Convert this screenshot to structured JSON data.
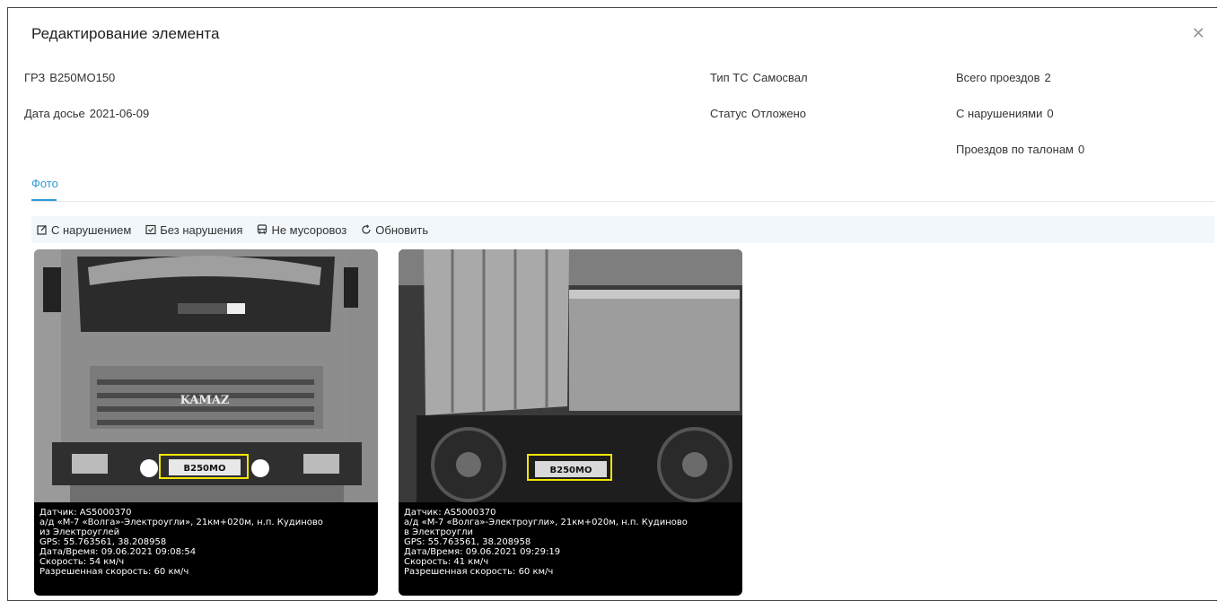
{
  "dialog": {
    "title": "Редактирование элемента",
    "close_icon": "close-icon"
  },
  "fields": {
    "grz": {
      "label": "ГРЗ",
      "value": "В250МО150"
    },
    "dossier_date": {
      "label": "Дата досье",
      "value": "2021-06-09"
    },
    "vehicle_type": {
      "label": "Тип ТС",
      "value": "Самосвал"
    },
    "status": {
      "label": "Статус",
      "value": "Отложено"
    },
    "total_passes": {
      "label": "Всего проездов",
      "value": "2"
    },
    "with_violations": {
      "label": "С нарушениями",
      "value": "0"
    },
    "coupon_passes": {
      "label": "Проездов по талонам",
      "value": "0"
    }
  },
  "tabs": [
    {
      "label": "Фото",
      "active": true
    }
  ],
  "toolbar": {
    "with_violation": "С нарушением",
    "without_violation": "Без нарушения",
    "not_garbage_truck": "Не мусоровоз",
    "refresh": "Обновить"
  },
  "photos": [
    {
      "plate": "В250МО",
      "region": "150",
      "brand": "KAMAZ",
      "caption": [
        "Датчик: AS5000370",
        "а/д «М-7 «Волга»-Электроугли», 21км+020м, н.п. Кудиново",
        "из Электроуглей",
        "GPS: 55.763561, 38.208958",
        "Дата/Время: 09.06.2021 09:08:54",
        "Скорость: 54 км/ч",
        "Разрешенная скорость: 60 км/ч"
      ]
    },
    {
      "plate": "В250МО",
      "region": "150",
      "caption": [
        "Датчик: AS5000370",
        "а/д «М-7 «Волга»-Электроугли», 21км+020м, н.п. Кудиново",
        "в Электроугли",
        "GPS: 55.763561, 38.208958",
        "Дата/Время: 09.06.2021 09:29:19",
        "Скорость: 41 км/ч",
        "Разрешенная скорость: 60 км/ч"
      ]
    }
  ],
  "colors": {
    "accent": "#2b9ad6",
    "plate_box": "#f2e600",
    "toolbar_bg": "#f2f7fb"
  }
}
